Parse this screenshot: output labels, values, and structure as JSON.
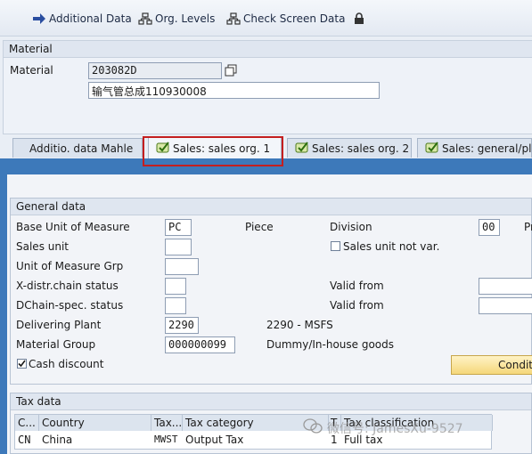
{
  "toolbar": {
    "additional_data": "Additional Data",
    "org_levels": "Org. Levels",
    "check_screen_data": "Check Screen Data"
  },
  "header": {
    "section_title": "Material",
    "material_label": "Material",
    "material_number": "203082D",
    "material_description": "输气管总成110930008"
  },
  "tabs": [
    {
      "label": "Additio. data Mahle",
      "active": false
    },
    {
      "label": "Sales: sales org. 1",
      "active": true
    },
    {
      "label": "Sales: sales org. 2",
      "active": false
    },
    {
      "label": "Sales: general/plant",
      "active": false
    }
  ],
  "general": {
    "title": "General data",
    "base_uom_label": "Base Unit of Measure",
    "base_uom_value": "PC",
    "base_uom_text": "Piece",
    "division_label": "Division",
    "division_value": "00",
    "division_trailing": "Pr",
    "sales_unit_label": "Sales unit",
    "sales_unit_value": "",
    "sales_unit_not_var_label": "Sales unit not var.",
    "sales_unit_not_var_checked": false,
    "uom_grp_label": "Unit of Measure Grp",
    "uom_grp_value": "",
    "xdistr_label": "X-distr.chain status",
    "xdistr_value": "",
    "xdistr_valid_from_label": "Valid from",
    "xdistr_valid_from_value": "",
    "dchain_label": "DChain-spec. status",
    "dchain_value": "",
    "dchain_valid_from_label": "Valid from",
    "dchain_valid_from_value": "",
    "delivering_plant_label": "Delivering Plant",
    "delivering_plant_value": "2290",
    "delivering_plant_text": "2290 - MSFS",
    "material_group_label": "Material Group",
    "material_group_value": "000000099",
    "material_group_text": "Dummy/In-house goods",
    "cash_discount_label": "Cash discount",
    "cash_discount_checked": true,
    "conditions_button": "Conditi"
  },
  "tax": {
    "title": "Tax data",
    "columns": [
      "C...",
      "Country",
      "Tax...",
      "Tax category",
      "T",
      "Tax classification"
    ],
    "rows": [
      {
        "c": "CN",
        "country": "China",
        "tax": "MWST",
        "category": "Output Tax",
        "t": "1",
        "classification": "Full tax"
      }
    ]
  },
  "watermark": "微信号: JamesXu-9527",
  "colors": {
    "highlight_border": "#c41f1f",
    "content_bg": "#3d79ba",
    "button_bg": "#f5d77a"
  }
}
